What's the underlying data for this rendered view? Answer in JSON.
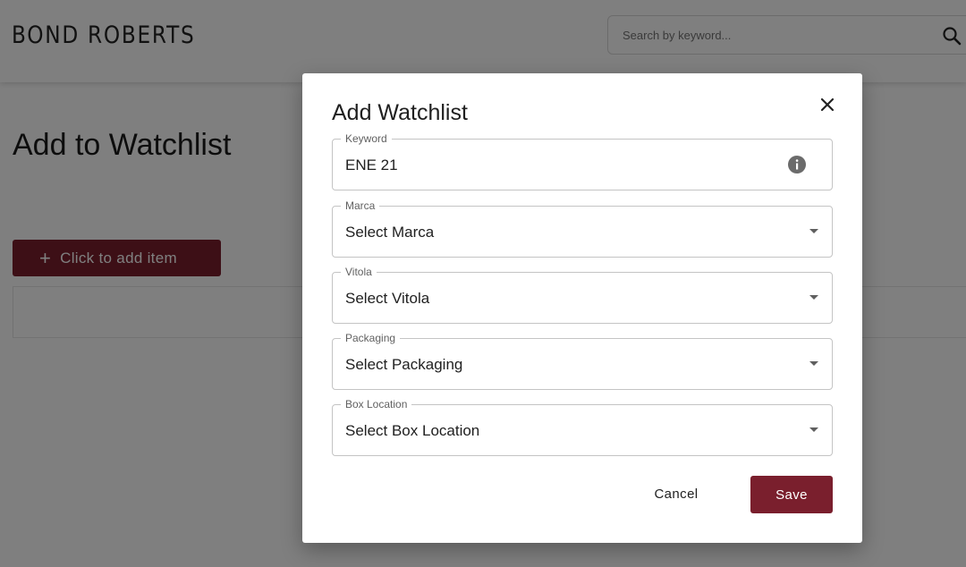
{
  "header": {
    "logo": "BOND ROBERTS",
    "search_placeholder": "Search by keyword..."
  },
  "page": {
    "title": "Add to Watchlist",
    "add_item_label": "Click to add item"
  },
  "modal": {
    "title": "Add Watchlist",
    "fields": [
      {
        "label": "Keyword",
        "value": "ENE 21",
        "kind": "text"
      },
      {
        "label": "Marca",
        "value": "Select Marca",
        "kind": "select"
      },
      {
        "label": "Vitola",
        "value": "Select Vitola",
        "kind": "select"
      },
      {
        "label": "Packaging",
        "value": "Select Packaging",
        "kind": "select"
      },
      {
        "label": "Box Location",
        "value": "Select Box Location",
        "kind": "select"
      }
    ],
    "cancel_label": "Cancel",
    "save_label": "Save"
  },
  "colors": {
    "brand": "#7a1f2d",
    "overlay": "rgba(0,0,0,0.5)"
  },
  "icons": [
    "search-icon",
    "plus-icon",
    "close-icon",
    "info-icon",
    "chevron-down-icon"
  ]
}
